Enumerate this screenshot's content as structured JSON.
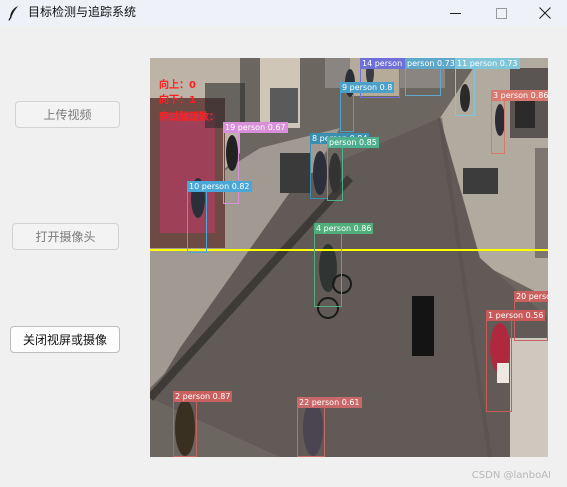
{
  "window": {
    "title": "目标检测与追踪系统",
    "icon": "feather-icon",
    "controls": {
      "minimize_icon": "minimize-icon",
      "maximize_icon": "maximize-icon",
      "close_icon": "close-icon"
    }
  },
  "sidebar": {
    "upload_video": "上传视频",
    "open_camera": "打开摄像头",
    "close_video_or_camera": "关闭视屏或摄像"
  },
  "video": {
    "counters": {
      "up": "向上：0",
      "down": "向下：1",
      "notice": "穿过隧道数："
    },
    "counting_line_color": "#ffff00",
    "detections": [
      {
        "label": "14 person 0.68",
        "color": "#6f6fd8"
      },
      {
        "label": "person 0.73",
        "color": "#5fa8c8"
      },
      {
        "label": "11 person 0.73",
        "color": "#7fc6d8"
      },
      {
        "label": "9 person 0.8",
        "color": "#4aa0c8"
      },
      {
        "label": "3 person 0.86",
        "color": "#d8786f"
      },
      {
        "label": "19 person 0.67",
        "color": "#d890d8"
      },
      {
        "label": "8 person 0.84",
        "color": "#3a8fb0"
      },
      {
        "label": "person 0.85",
        "color": "#4fb090"
      },
      {
        "label": "10 person 0.82",
        "color": "#4aa8d8"
      },
      {
        "label": "4 person 0.86",
        "color": "#4fae7a"
      },
      {
        "label": "20 person",
        "color": "#c86060"
      },
      {
        "label": "1 person 0.56",
        "color": "#c85a5a"
      },
      {
        "label": "2 person 0.87",
        "color": "#c86060"
      },
      {
        "label": "22 person 0.61",
        "color": "#c86868"
      }
    ]
  },
  "watermark": "CSDN @lanboAI"
}
